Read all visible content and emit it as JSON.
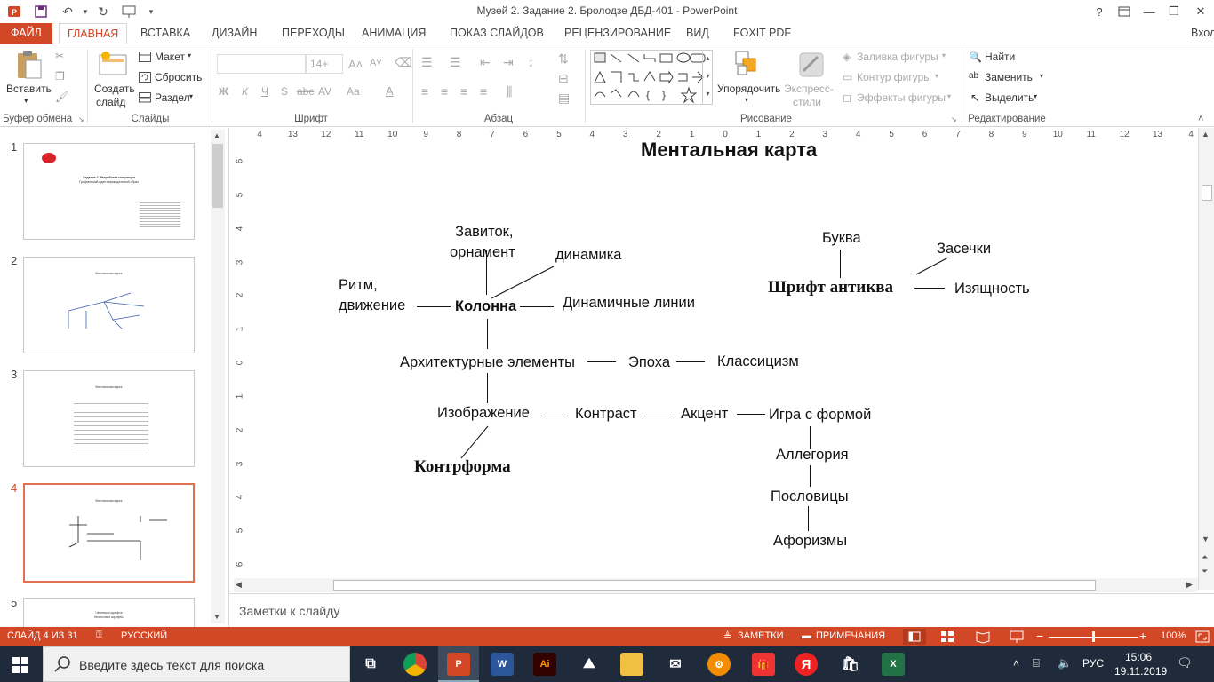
{
  "titlebar": {
    "title": "Музей 2. Задание 2. Бролодзе ДБД-401 - PowerPoint",
    "help": "?",
    "qat_dropdown": "▾"
  },
  "tabs": [
    "ФАЙЛ",
    "ГЛАВНАЯ",
    "ВСТАВКА",
    "ДИЗАЙН",
    "ПЕРЕХОДЫ",
    "АНИМАЦИЯ",
    "ПОКАЗ СЛАЙДОВ",
    "РЕЦЕНЗИРОВАНИЕ",
    "ВИД",
    "FOXIT PDF"
  ],
  "signin": "Вход",
  "ribbon": {
    "clipboard": {
      "paste": "Вставить",
      "label": "Буфер обмена"
    },
    "slides": {
      "new_slide_1": "Создать",
      "new_slide_2": "слайд",
      "layout": "Макет",
      "reset": "Сбросить",
      "section": "Раздел",
      "label": "Слайды"
    },
    "font": {
      "size": "14+",
      "label": "Шрифт",
      "bold": "Ж",
      "italic": "К",
      "underline": "Ч",
      "shadow": "S",
      "strike": "abc",
      "spacing": "AV",
      "case": "Aa"
    },
    "paragraph": {
      "label": "Абзац"
    },
    "drawing": {
      "arrange": "Упорядочить",
      "quick_styles_1": "Экспресс-",
      "quick_styles_2": "стили",
      "fill": "Заливка фигуры",
      "outline": "Контур фигуры",
      "effects": "Эффекты фигуры",
      "label": "Рисование"
    },
    "editing": {
      "find": "Найти",
      "replace": "Заменить",
      "select": "Выделить",
      "label": "Редактирование"
    }
  },
  "slides_pane": {
    "slides": [
      {
        "num": "1",
        "lines": [
          "Задание 2. Разработка концепции",
          "Графический идентификационный образ"
        ]
      },
      {
        "num": "2",
        "lines": [
          "Ментальная карта"
        ]
      },
      {
        "num": "3",
        "lines": [
          "Ментальная карта"
        ]
      },
      {
        "num": "4",
        "lines": [
          "Ментальная карта"
        ]
      },
      {
        "num": "5",
        "lines": [
          "Чеснешок шрифта",
          "Кнопочные шрифты"
        ]
      }
    ]
  },
  "ruler": {
    "h": [
      "4",
      "13",
      "12",
      "11",
      "10",
      "9",
      "8",
      "7",
      "6",
      "5",
      "4",
      "3",
      "2",
      "1",
      "0",
      "1",
      "2",
      "3",
      "4",
      "5",
      "6",
      "7",
      "8",
      "9",
      "10",
      "11",
      "12",
      "13",
      "4"
    ],
    "v": [
      "6",
      "5",
      "4",
      "3",
      "2",
      "1",
      "0",
      "1",
      "2",
      "3",
      "4",
      "5",
      "6"
    ]
  },
  "slide": {
    "title": "Ментальная карта",
    "nodes": {
      "zavitok_1": "Завиток,",
      "zavitok_2": "орнамент",
      "dinamika": "динамика",
      "ritm_1": "Ритм,",
      "ritm_2": "движение",
      "kolonna": "Колонна",
      "din_linii": "Динамичные линии",
      "arch": "Архитектурные элементы",
      "epoha": "Эпоха",
      "klass": "Классицизм",
      "izobr": "Изображение",
      "kontrast": "Контраст",
      "akcent": "Акцент",
      "igra": "Игра с формой",
      "kontrforma": "Контрформа",
      "allegoria": "Аллегория",
      "poslov": "Пословицы",
      "aforizmy": "Афоризмы",
      "bukva": "Буква",
      "zasechki": "Засечки",
      "shrift": "Шрифт антиква",
      "izyash": "Изящность"
    }
  },
  "notes": {
    "placeholder": "Заметки к слайду"
  },
  "status": {
    "slide": "СЛАЙД 4 ИЗ 31",
    "lang": "РУССКИЙ",
    "notes": "ЗАМЕТКИ",
    "comments": "ПРИМЕЧАНИЯ",
    "zoom": "100%",
    "zoom_level": 0.5
  },
  "taskbar": {
    "search_placeholder": "Введите здесь текст для поиска",
    "lang": "РУС",
    "time": "15:06",
    "date": "19.11.2019"
  }
}
